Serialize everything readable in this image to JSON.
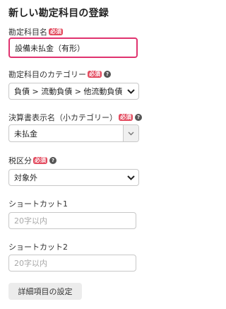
{
  "title": "新しい勘定科目の登録",
  "required_badge": "必須",
  "account_name": {
    "label": "勘定科目名",
    "value": "設備未払金（有形）"
  },
  "category": {
    "label": "勘定科目のカテゴリー",
    "value": "負債 > 流動負債 > 他流動負債"
  },
  "statement_name": {
    "label": "決算書表示名（小カテゴリー）",
    "value": "未払金"
  },
  "tax_class": {
    "label": "税区分",
    "value": "対象外"
  },
  "shortcut1": {
    "label": "ショートカット1",
    "placeholder": "20字以内"
  },
  "shortcut2": {
    "label": "ショートカット2",
    "placeholder": "20字以内"
  },
  "detail_button": "詳細項目の設定",
  "icons": {
    "help": "question-circle-icon",
    "dropdown": "chevron-down-icon"
  },
  "colors": {
    "required_badge": "#e34b5f",
    "focus_border": "#e0336f"
  }
}
